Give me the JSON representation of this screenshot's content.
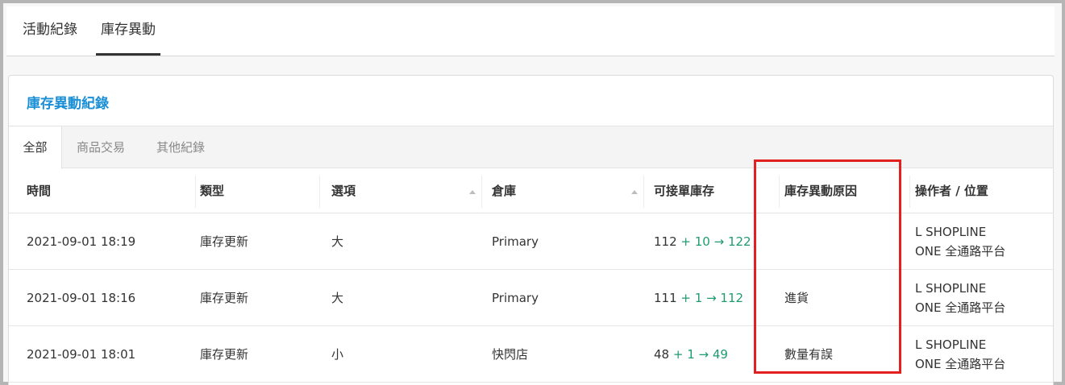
{
  "top_tabs": [
    {
      "label": "活動紀錄",
      "active": false
    },
    {
      "label": "庫存異動",
      "active": true
    }
  ],
  "panel": {
    "title": "庫存異動紀錄",
    "sub_tabs": [
      {
        "label": "全部",
        "active": true
      },
      {
        "label": "商品交易",
        "active": false
      },
      {
        "label": "其他紀錄",
        "active": false
      }
    ]
  },
  "table": {
    "headers": {
      "time": "時間",
      "type": "類型",
      "option": "選項",
      "warehouse": "倉庫",
      "orderable": "可接單庫存",
      "reason": "庫存異動原因",
      "operator": "操作者 / 位置"
    },
    "rows": [
      {
        "time": "2021-09-01 18:19",
        "type": "庫存更新",
        "option": "大",
        "warehouse": "Primary",
        "stock_before": "112",
        "stock_change": "+ 10 → 122",
        "reason": "",
        "operator_line1": "L SHOPLINE",
        "operator_line2": "ONE 全通路平台"
      },
      {
        "time": "2021-09-01 18:16",
        "type": "庫存更新",
        "option": "大",
        "warehouse": "Primary",
        "stock_before": "111",
        "stock_change": "+ 1 → 112",
        "reason": "進貨",
        "operator_line1": "L SHOPLINE",
        "operator_line2": "ONE 全通路平台"
      },
      {
        "time": "2021-09-01 18:01",
        "type": "庫存更新",
        "option": "小",
        "warehouse": "快閃店",
        "stock_before": "48",
        "stock_change": "+ 1 → 49",
        "reason": "數量有誤",
        "operator_line1": "L SHOPLINE",
        "operator_line2": "ONE 全通路平台"
      }
    ]
  },
  "colors": {
    "accent": "#1a8fd6",
    "stock_increase": "#1f9b6e",
    "highlight_box": "#e32020"
  },
  "icons": [
    "sort-ascending-icon"
  ]
}
